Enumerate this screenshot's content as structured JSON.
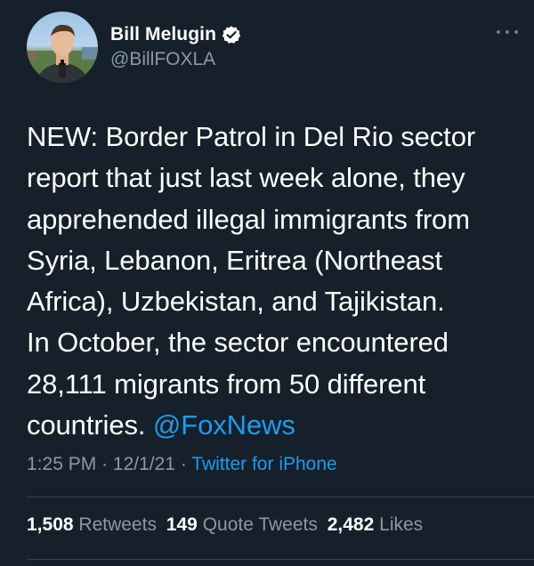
{
  "author": {
    "display_name": "Bill Melugin",
    "handle": "@BillFOXLA",
    "verified": true
  },
  "icons": {
    "verified": "verified-badge-icon",
    "more": "more-options-icon"
  },
  "tweet": {
    "lines": [
      "NEW: Border Patrol in Del Rio sector",
      "report that just last week alone, they",
      "apprehended illegal immigrants from",
      "Syria, Lebanon, Eritrea (Northeast",
      "Africa), Uzbekistan, and Tajikistan.",
      "In October, the sector encountered",
      "28,111 migrants from 50 different",
      "countries."
    ],
    "mention": "@FoxNews"
  },
  "meta": {
    "time": "1:25 PM",
    "date": "12/1/21",
    "separator": "·",
    "source": "Twitter for iPhone"
  },
  "stats": {
    "retweets_count": "1,508",
    "retweets_label": "Retweets",
    "quote_count": "149",
    "quote_label": "Quote Tweets",
    "likes_count": "2,482",
    "likes_label": "Likes"
  },
  "colors": {
    "background": "#15202b",
    "text": "#ffffff",
    "secondary_text": "#8b98a5",
    "link": "#1d9bf0",
    "divider": "#38444d"
  }
}
